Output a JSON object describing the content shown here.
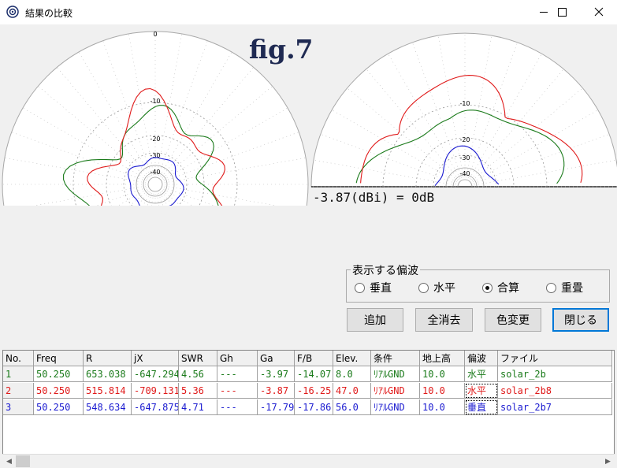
{
  "window": {
    "title": "結果の比較",
    "minimize_icon": "minimize-icon",
    "maximize_icon": "maximize-icon",
    "close_icon": "close-icon"
  },
  "figure_label": "fig.7",
  "gain_reference": "-3.87(dBi) = 0dB",
  "polar": {
    "ring_labels": [
      "0",
      "-10",
      "-20",
      "-30",
      "-40"
    ],
    "colors": {
      "grid": "#9a9a9a",
      "trace1": "#1a7a1a",
      "trace2": "#e01a1a",
      "trace3": "#1a1ad0"
    }
  },
  "polarization": {
    "title": "表示する偏波",
    "options": [
      {
        "label": "垂直",
        "checked": false
      },
      {
        "label": "水平",
        "checked": false
      },
      {
        "label": "合算",
        "checked": true
      },
      {
        "label": "重畳",
        "checked": false
      }
    ]
  },
  "buttons": {
    "add": "追加",
    "clear_all": "全消去",
    "color_change": "色変更",
    "close": "閉じる"
  },
  "table": {
    "headers": [
      "No.",
      "Freq",
      "R",
      "jX",
      "SWR",
      "Gh",
      "Ga",
      "F/B",
      "Elev.",
      "条件",
      "地上高",
      "偏波",
      "ファイル"
    ],
    "rows": [
      {
        "color": "#1a7a1a",
        "cells": [
          "1",
          "50.250",
          "653.038",
          "-647.294",
          "4.56",
          "---",
          "-3.97",
          "-14.07",
          "8.0",
          "ﾘｱﾙGND",
          "10.0",
          "水平",
          "solar_2b"
        ]
      },
      {
        "color": "#e01a1a",
        "cells": [
          "2",
          "50.250",
          "515.814",
          "-709.131",
          "5.36",
          "---",
          "-3.87",
          "-16.25",
          "47.0",
          "ﾘｱﾙGND",
          "10.0",
          "水平",
          "solar_2b8"
        ]
      },
      {
        "color": "#1a1ad0",
        "cells": [
          "3",
          "50.250",
          "548.634",
          "-647.875",
          "4.71",
          "---",
          "-17.79",
          "-17.86",
          "56.0",
          "ﾘｱﾙGND",
          "10.0",
          "垂直",
          "solar_2b7"
        ]
      }
    ]
  }
}
